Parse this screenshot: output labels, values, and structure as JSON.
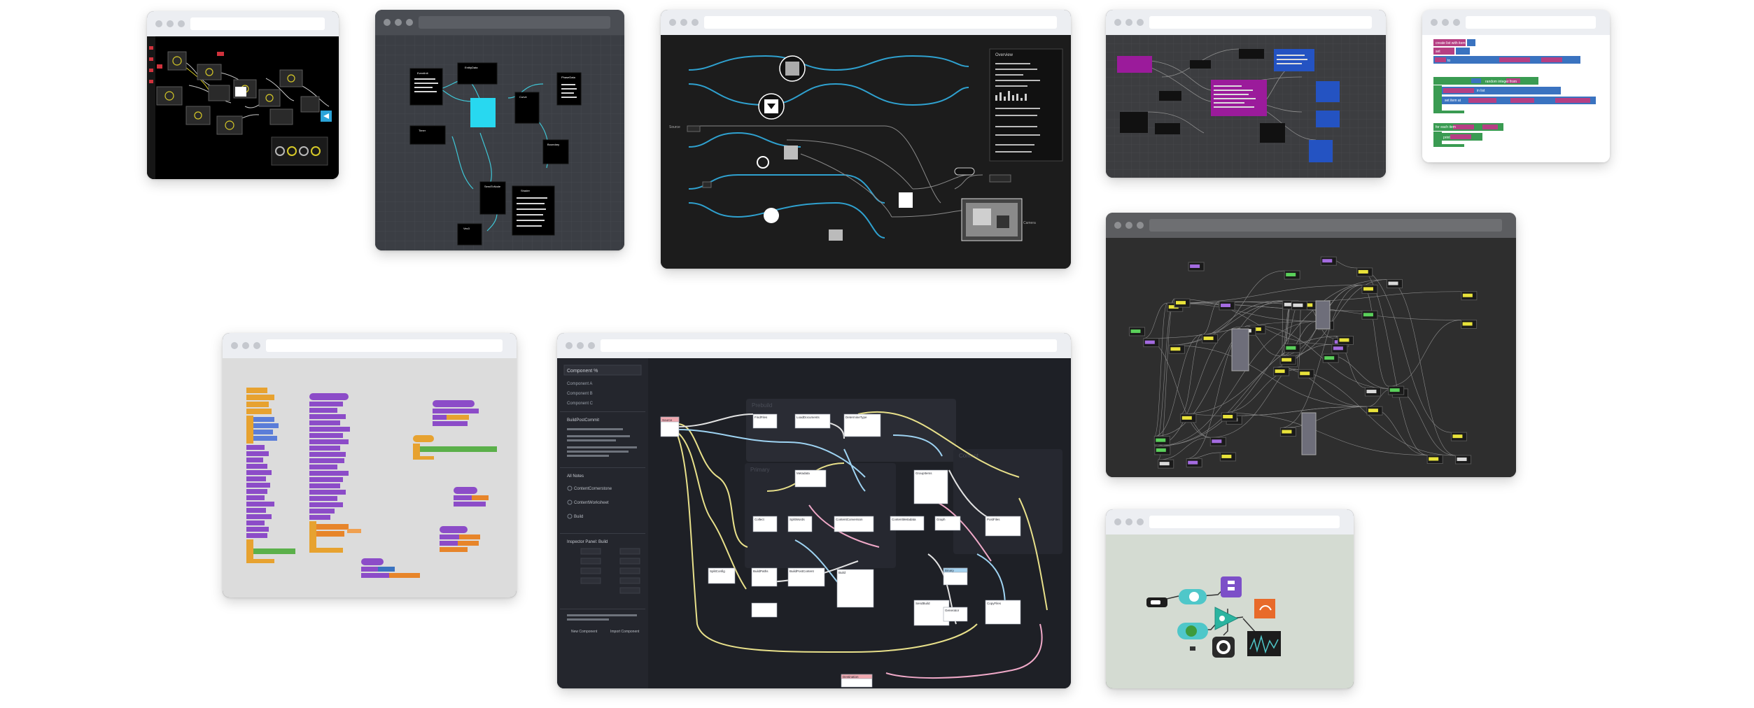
{
  "page": {
    "title": ""
  },
  "windows": [
    {
      "id": "w1",
      "kind": "audio-patcher"
    },
    {
      "id": "w2",
      "kind": "node-graph-dark"
    },
    {
      "id": "w3",
      "kind": "pipeline-graph",
      "panel_title": "Overview",
      "camera_label": "Camera"
    },
    {
      "id": "w4",
      "kind": "purple-blue-graph"
    },
    {
      "id": "w5",
      "kind": "blocks-code",
      "blocks": [
        "create list with item",
        "set",
        "to",
        "item",
        "count",
        "last",
        "from",
        "to",
        "random integer from",
        "do",
        "in list",
        "set item at",
        "to",
        "for each item",
        "in list",
        "print"
      ]
    },
    {
      "id": "w6",
      "kind": "dense-node-graph"
    },
    {
      "id": "w7",
      "kind": "scratch-blocks"
    },
    {
      "id": "w8",
      "kind": "build-graph",
      "sidebar": {
        "search": "Component %",
        "items": [
          "Component A",
          "Component B",
          "Component C"
        ],
        "selected": "BuildPostCommit",
        "note_title": "All Notes",
        "notes": [
          "ContentCornerstone",
          "ContentWorksheet",
          "Build"
        ],
        "inspector_title": "Inspector Panel: Build",
        "footer_left": "New Component",
        "footer_right": "Import Component"
      },
      "groups": [
        "Prebuild",
        "Primary",
        "Content"
      ],
      "nodes": [
        "Source",
        "FindFiles",
        "LoadDocuments",
        "DetermineType",
        "Metadata",
        "Collect",
        "SplitWords",
        "ContentConversion",
        "ContentMetadata",
        "Graph",
        "PostFiles",
        "GroupItems",
        "BuildPaths",
        "BuildPostContent",
        "Build",
        "Binary",
        "SplitConfig",
        "SendBuild",
        "Generator",
        "CopyFiles",
        "Destination"
      ]
    },
    {
      "id": "w9",
      "kind": "kids-flow-robot"
    }
  ]
}
